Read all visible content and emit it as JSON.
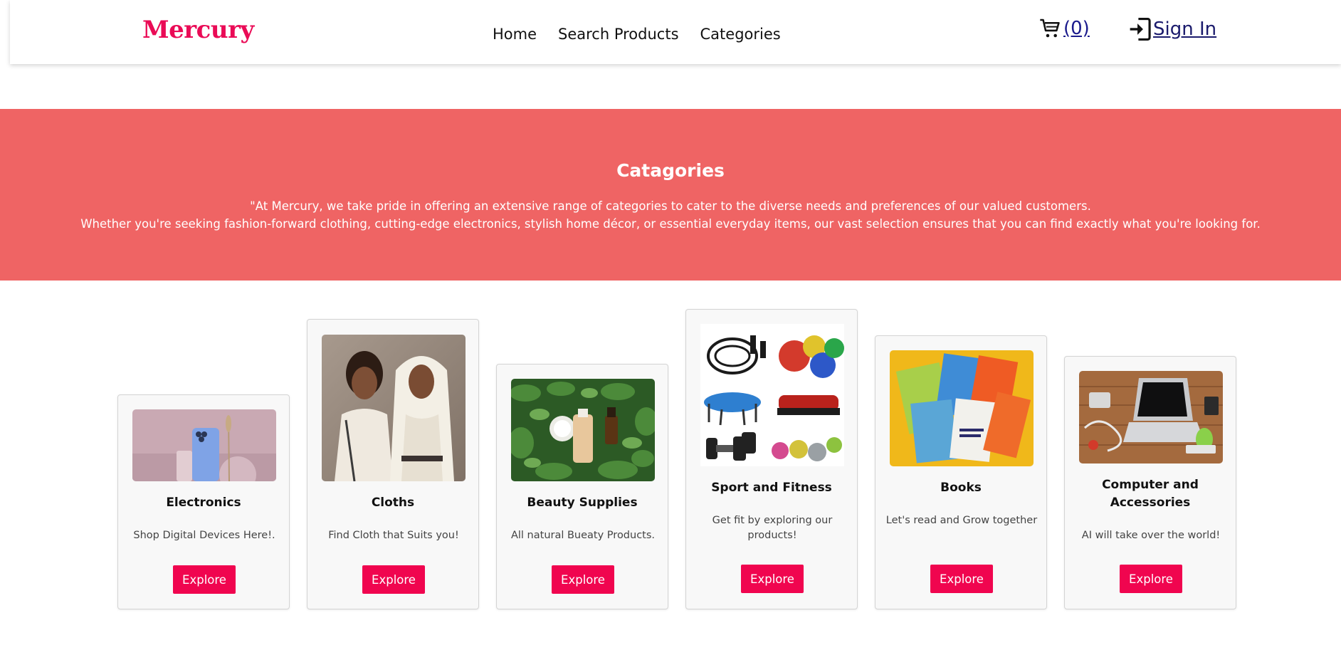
{
  "brand": "Mercury",
  "nav": {
    "links": [
      "Home",
      "Search Products",
      "Categories"
    ],
    "cart_count": "(0)",
    "signin_label": "Sign In"
  },
  "hero": {
    "title": "Catagories",
    "line1": "\"At Mercury, we take pride in offering an extensive range of categories to cater to the diverse needs and preferences of our valued customers.",
    "line2": "Whether you're seeking fashion-forward clothing, cutting-edge electronics, stylish home décor, or essential everyday items, our vast selection ensures that you can find exactly what you're looking for."
  },
  "categories": [
    {
      "title": "Electronics",
      "desc": "Shop Digital Devices Here!.",
      "button": "Explore",
      "image": "phone-photo"
    },
    {
      "title": "Cloths",
      "desc": "Find Cloth that Suits you!",
      "button": "Explore",
      "image": "women-clothing-photo"
    },
    {
      "title": "Beauty Supplies",
      "desc": "All natural Bueaty Products.",
      "button": "Explore",
      "image": "skincare-photo"
    },
    {
      "title": "Sport and Fitness",
      "desc": "Get fit by exploring our products!",
      "button": "Explore",
      "image": "fitness-equipment-photo"
    },
    {
      "title": "Books",
      "desc": "Let's read and Grow together",
      "button": "Explore",
      "image": "books-photo"
    },
    {
      "title": "Computer and Accessories",
      "desc": "AI will take over the world!",
      "button": "Explore",
      "image": "laptop-accessories-photo"
    }
  ],
  "colors": {
    "brand": "#ea0b56",
    "hero_bg": "#ef6464",
    "button_bg": "#f0054f"
  }
}
